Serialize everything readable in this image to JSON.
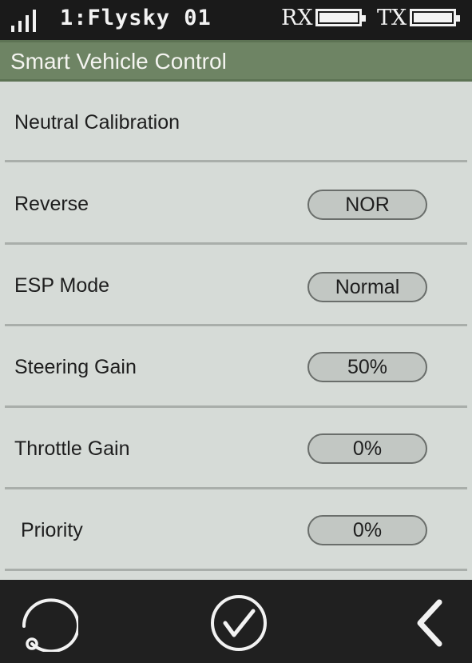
{
  "status": {
    "model": "1:Flysky 01",
    "rx_label": "RX",
    "tx_label": "TX"
  },
  "title": "Smart Vehicle Control",
  "rows": [
    {
      "label": "Neutral Calibration",
      "value": ""
    },
    {
      "label": "Reverse",
      "value": "NOR"
    },
    {
      "label": "ESP Mode",
      "value": "Normal"
    },
    {
      "label": "Steering Gain",
      "value": "50%"
    },
    {
      "label": "Throttle Gain",
      "value": "0%"
    },
    {
      "label": "Priority",
      "value": "0%"
    }
  ],
  "toolbar": {
    "icons": [
      "reset-icon",
      "confirm-icon",
      "back-icon"
    ]
  },
  "colors": {
    "title_bar": "#6e8464",
    "content_bg": "#d6dbd7",
    "status_bar": "#1a1a1a",
    "pill_bg": "#c2c7c3"
  }
}
